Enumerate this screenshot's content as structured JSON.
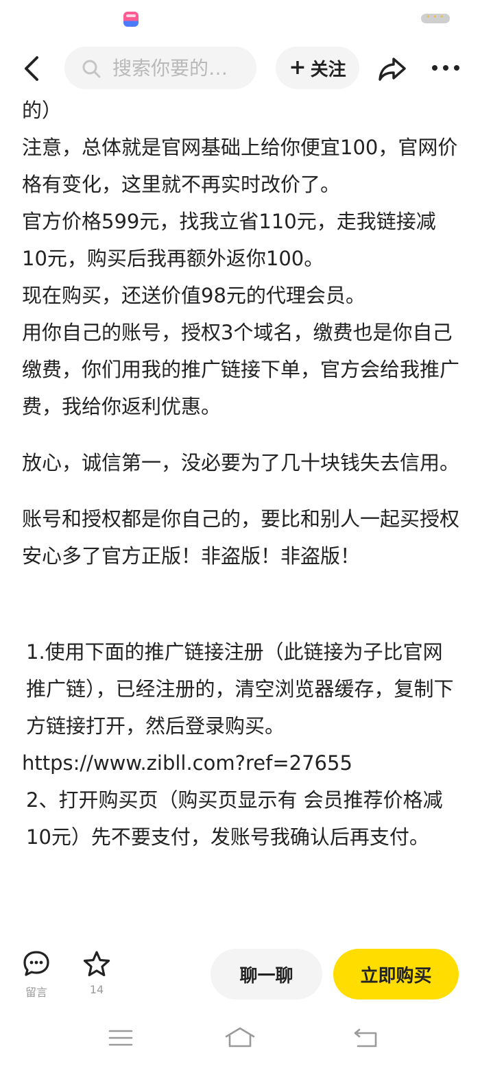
{
  "search": {
    "placeholder": "搜索你要的…"
  },
  "header": {
    "follow_label": "关注"
  },
  "article": {
    "lines": [
      "的）",
      "注意，总体就是官网基础上给你便宜100，官网价格有变化，这里就不再实时改价了。",
      "官方价格599元，找我立省110元，走我链接减10元，购买后我再额外返你100。",
      "现在购买，还送价值98元的代理会员。",
      "用你自己的账号，授权3个域名，缴费也是你自己缴费，你们用我的推广链接下单，官方会给我推广费，我给你返利优惠。",
      "放心，诚信第一，没必要为了几十块钱失去信用。",
      "账号和授权都是你自己的，要比和别人一起买授权安心多了官方正版！非盗版！非盗版！",
      "1.使用下面的推广链接注册（此链接为子比官网推广链），已经注册的，清空浏览器缓存，复制下方链接打开，然后登录购买。",
      "https://www.zibll.com?ref=27655",
      "2、打开购买页（购买页显示有 会员推荐价格减10元）先不要支付，发账号我确认后再支付。"
    ]
  },
  "bottom_bar": {
    "comment_label": "留言",
    "favorite_count": "14",
    "chat_label": "聊一聊",
    "buy_label": "立即购买"
  },
  "colors": {
    "accent": "#ffdd00",
    "pill_bg": "#f4f4f4",
    "text": "#222222",
    "muted": "#9a9a9a"
  }
}
